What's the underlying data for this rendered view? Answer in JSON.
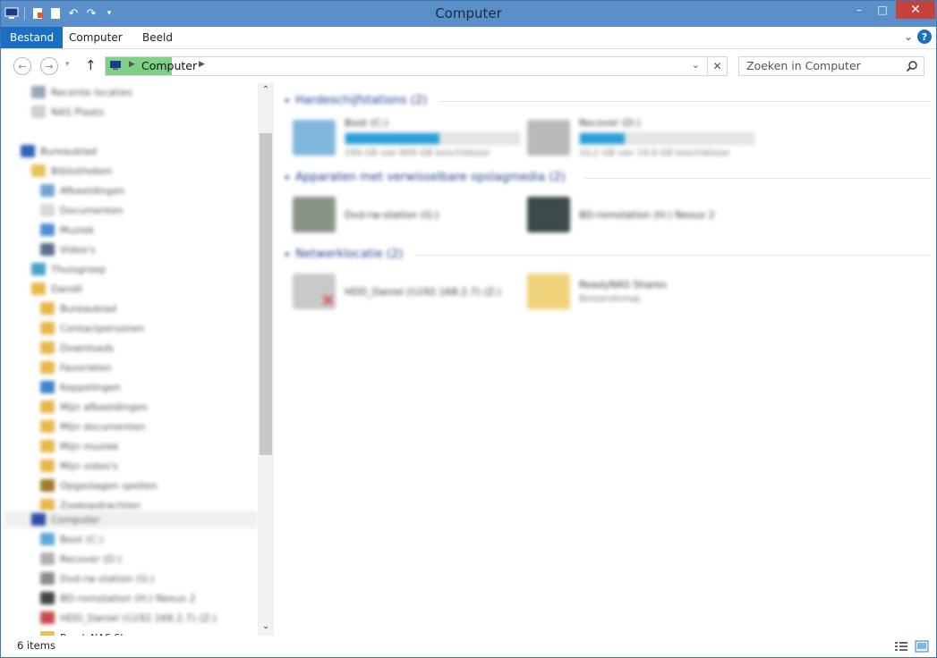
{
  "window": {
    "title": "Computer"
  },
  "titlebar": {
    "min_glyph": "–",
    "max_glyph": "□",
    "close_glyph": "✕"
  },
  "ribbon": {
    "tabs": [
      {
        "label": "Bestand",
        "active": true
      },
      {
        "label": "Computer",
        "active": false
      },
      {
        "label": "Beeld",
        "active": false
      }
    ],
    "help_glyph": "?"
  },
  "navigation": {
    "address_text": "Computer",
    "search_placeholder": "Zoeken in Computer"
  },
  "sidebar": {
    "items": [
      {
        "label": "Recente locaties",
        "level": 1,
        "color": "#9aa6b8"
      },
      {
        "label": "NAS Plaats",
        "level": 1,
        "color": "#cfcfcf"
      },
      {
        "label": "Bureaublad",
        "level": 0,
        "color": "#2f62b9"
      },
      {
        "label": "Bibliotheken",
        "level": 1,
        "color": "#e6c35a"
      },
      {
        "label": "Afbeeldingen",
        "level": 2,
        "color": "#6fa5d0"
      },
      {
        "label": "Documenten",
        "level": 2,
        "color": "#d8d8d8"
      },
      {
        "label": "Muziek",
        "level": 2,
        "color": "#4f8ed6"
      },
      {
        "label": "Video's",
        "level": 2,
        "color": "#5b6f8c"
      },
      {
        "label": "Thuisgroep",
        "level": 1,
        "color": "#4aa0c8"
      },
      {
        "label": "Daniël",
        "level": 1,
        "color": "#e7b84a"
      },
      {
        "label": "Bureaublad",
        "level": 2,
        "color": "#e7b84a"
      },
      {
        "label": "Contactpersonen",
        "level": 2,
        "color": "#e7b84a"
      },
      {
        "label": "Downloads",
        "level": 2,
        "color": "#e7b84a"
      },
      {
        "label": "Favorieten",
        "level": 2,
        "color": "#e7b84a"
      },
      {
        "label": "Koppelingen",
        "level": 2,
        "color": "#3e85c8"
      },
      {
        "label": "Mijn afbeeldingen",
        "level": 2,
        "color": "#e7b84a"
      },
      {
        "label": "Mijn documenten",
        "level": 2,
        "color": "#e7b84a"
      },
      {
        "label": "Mijn muziek",
        "level": 2,
        "color": "#e7b84a"
      },
      {
        "label": "Mijn video's",
        "level": 2,
        "color": "#e7b84a"
      },
      {
        "label": "Opgeslagen spellen",
        "level": 2,
        "color": "#a07a2a"
      },
      {
        "label": "Zoekopdrachten",
        "level": 2,
        "color": "#e7b84a"
      },
      {
        "label": "Computer",
        "level": 1,
        "color": "#2e4ea8",
        "selected": true
      },
      {
        "label": "Boot (C:)",
        "level": 2,
        "color": "#5aa7d6"
      },
      {
        "label": "Recover (D:)",
        "level": 2,
        "color": "#b0b0b0"
      },
      {
        "label": "Dvd-rw-station (G:)",
        "level": 2,
        "color": "#8a8a8a"
      },
      {
        "label": "BD-romstation (H:) Nexus 2",
        "level": 2,
        "color": "#444444"
      },
      {
        "label": "HDD_Daniel (\\\\192.168.2.7) (Z:)",
        "level": 2,
        "color": "#c74a4a"
      },
      {
        "label": "ReadyNAS Shares",
        "level": 2,
        "color": "#e7c35a",
        "sharp": true
      }
    ]
  },
  "groups": [
    {
      "title": "Hardeschijfstations (2)",
      "items": [
        {
          "name": "Boot (C:)",
          "detail": "299 GB van 869 GB beschikbaar",
          "used_fraction": 0.54,
          "icon_color": "#7fb7dd"
        },
        {
          "name": "Recover (D:)",
          "detail": "10,2 GB van 19,9 GB beschikbaar",
          "used_fraction": 0.26,
          "icon_color": "#b9b9b9"
        }
      ]
    },
    {
      "title": "Apparaten met verwisselbare opslagmedia (2)",
      "items": [
        {
          "name": "Dvd-rw-station (G:)",
          "icon_color": "#8a9486"
        },
        {
          "name": "BD-romstation (H:) Nexus 2",
          "icon_color": "#3c4a4a"
        }
      ]
    },
    {
      "title": "Netwerklocatie (2)",
      "items": [
        {
          "name": "HDD_Daniel (\\\\192.168.2.7) (Z:)",
          "icon_color": "#c9c9c9",
          "badge_color": "#d62b2b"
        },
        {
          "name": "ReadyNAS Shares",
          "detail": "Bestandsmap",
          "icon_color": "#efd27a"
        }
      ]
    }
  ],
  "status": {
    "item_count": "6 items"
  },
  "colors": {
    "titlebar": "#5a8fc9",
    "ribbon_active": "#1a6fc2",
    "group_header": "#1e3d8a",
    "capacity_bar": "#26a0da",
    "address_highlight": "#7ed187"
  }
}
